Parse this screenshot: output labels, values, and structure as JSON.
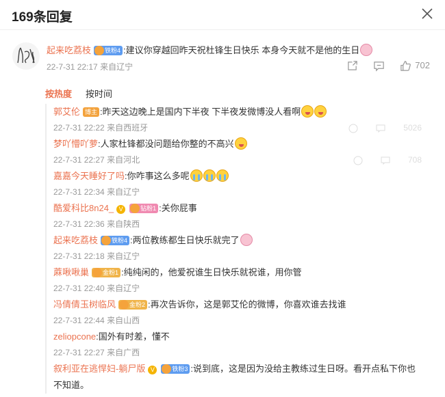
{
  "dialog": {
    "title": "169条回复"
  },
  "main_comment": {
    "username": "起来吃荔枝",
    "badge": "铁粉4",
    "text": ":建议你穿越回昨天祝杜锋生日快乐 本身今天就不是他的生日",
    "date": "22-7-31 22:17",
    "location": "来自辽宁",
    "likes": "702"
  },
  "tabs": [
    {
      "label": "按热度"
    },
    {
      "label": "按时间"
    }
  ],
  "ghost_likes": [
    "5026",
    "708"
  ],
  "replies": [
    {
      "username": "郭艾伦",
      "badge": "博主",
      "text": ":昨天这边晚上是国内下半夜 下半夜发微博没人看啊",
      "date": "22-7-31 22:22",
      "location": "来自西班牙"
    },
    {
      "username": "梦吖懵吖萝",
      "text": ":人家杜锋都没问题给你整的不高兴",
      "date": "22-7-31 22:27",
      "location": "来自河北"
    },
    {
      "username": "嘉嘉今天睡好了吗",
      "text": ":你咋事这么多呢",
      "date": "22-7-31 22:34",
      "location": "来自辽宁"
    },
    {
      "username": "酷爱科比8n24_",
      "badge": "钻粉1",
      "text": ":关你屁事",
      "date": "22-7-31 22:36",
      "location": "来自陕西"
    },
    {
      "username": "起来吃荔枝",
      "badge": "铁粉4",
      "text": ":两位教练都生日快乐就完了",
      "date": "22-7-31 22:18",
      "location": "来自辽宁"
    },
    {
      "username": "蔴啾啾巢",
      "badge": "金粉1",
      "text": ":纯纯闲的，他爱祝谁生日快乐就祝谁，用你管",
      "date": "22-7-31 22:40",
      "location": "来自辽宁"
    },
    {
      "username": "冯倩倩玉树临风",
      "badge": "金粉2",
      "text": ":再次告诉你，这是郭艾伦的微博，你喜欢谁去找谁",
      "date": "22-7-31 22:44",
      "location": "来自山西"
    },
    {
      "username": "zeliopcone",
      "text": ":国外有时差，懂不",
      "date": "22-7-31 22:27",
      "location": "来自广西"
    },
    {
      "username": "叙利亚在逃悍妇-躺尸版",
      "badge": "铁粉3",
      "text": ":说到底，这是因为没给主教练过生日呀。看开点私下你也不知道。"
    }
  ]
}
